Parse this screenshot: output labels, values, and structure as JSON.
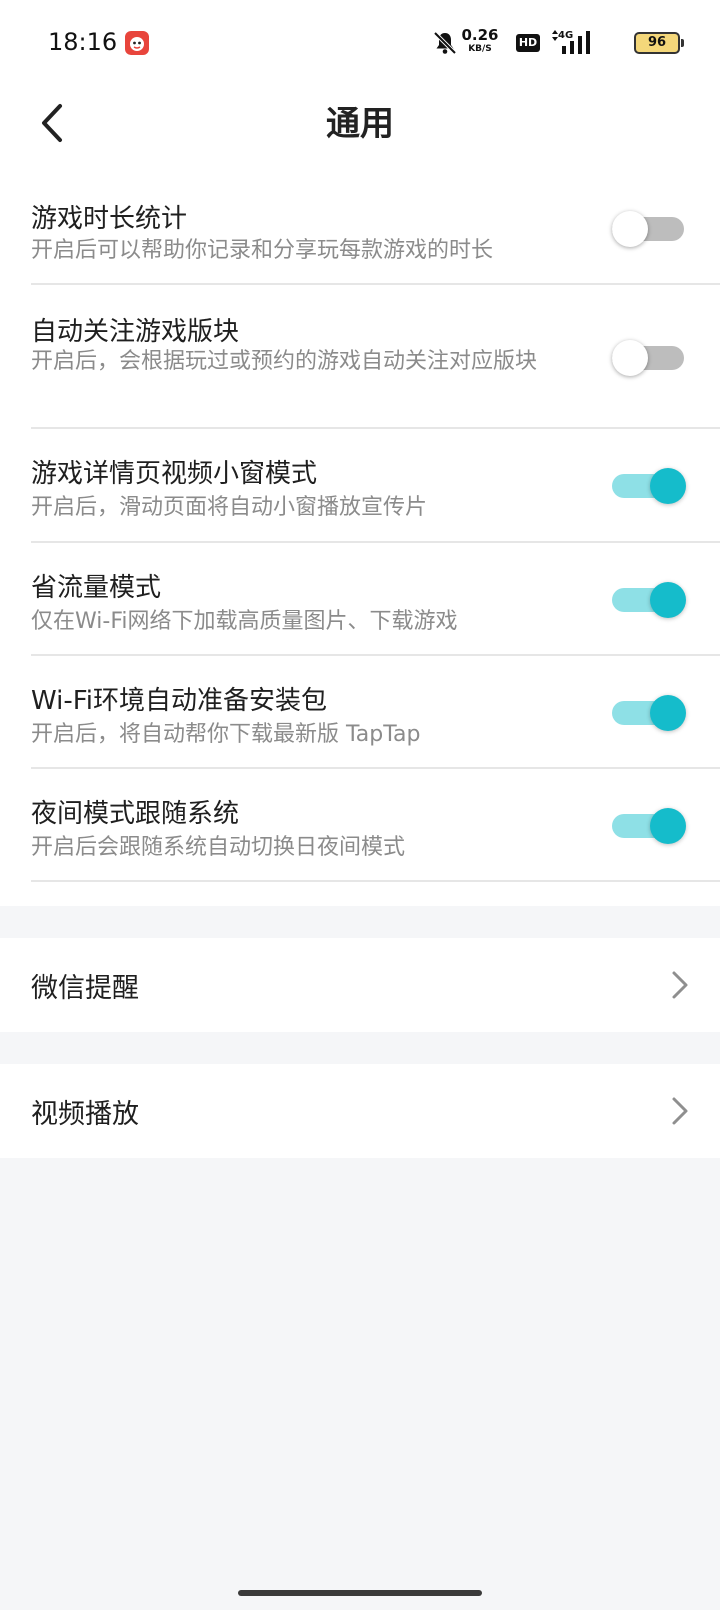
{
  "status_bar": {
    "time": "18:16",
    "net_speed_value": "0.26",
    "net_speed_unit": "KB/S",
    "hd_label": "HD",
    "network_type": "4G",
    "battery_level": "96",
    "icons": [
      "app-notification-icon",
      "bell-muted-icon",
      "signal-icon",
      "battery-icon"
    ]
  },
  "header": {
    "title": "通用",
    "back_icon": "chevron-left-icon"
  },
  "settings": [
    {
      "title": "游戏时长统计",
      "subtitle": "开启后可以帮助你记录和分享玩每款游戏的时长",
      "enabled": false
    },
    {
      "title": "自动关注游戏版块",
      "subtitle": "开启后，会根据玩过或预约的游戏自动关注对应版块",
      "enabled": false
    },
    {
      "title": "游戏详情页视频小窗模式",
      "subtitle": "开启后，滑动页面将自动小窗播放宣传片",
      "enabled": true
    },
    {
      "title": "省流量模式",
      "subtitle": "仅在Wi-Fi网络下加载高质量图片、下载游戏",
      "enabled": true
    },
    {
      "title": "Wi-Fi环境自动准备安装包",
      "subtitle": "开启后，将自动帮你下载最新版 TapTap",
      "enabled": true
    },
    {
      "title": "夜间模式跟随系统",
      "subtitle": "开启后会跟随系统自动切换日夜间模式",
      "enabled": true
    }
  ],
  "nav_items": [
    {
      "label": "微信提醒",
      "icon": "chevron-right-icon"
    },
    {
      "label": "视频播放",
      "icon": "chevron-right-icon"
    }
  ],
  "colors": {
    "toggle_on_knob": "#15bccb",
    "toggle_on_track": "#8ee0e6",
    "toggle_off_track": "#bdbdbd",
    "page_background": "#f5f6f8"
  }
}
